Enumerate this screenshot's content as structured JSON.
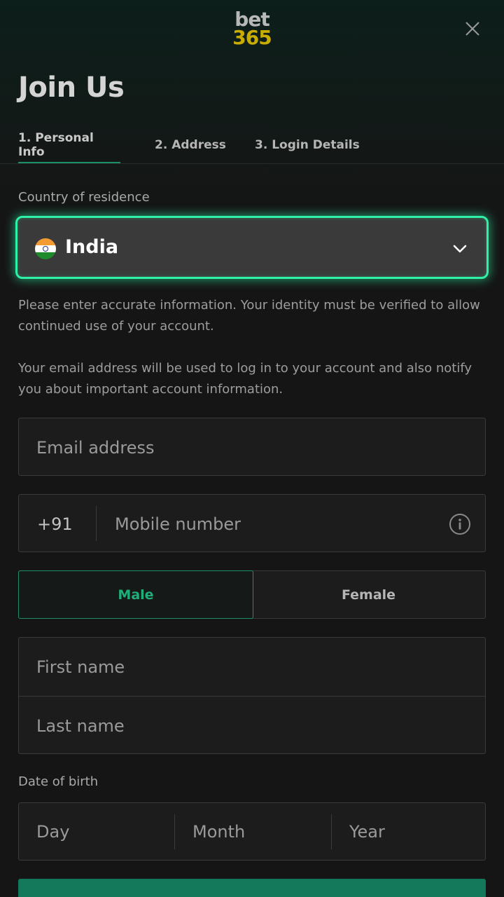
{
  "header": {
    "logo_line1": "bet",
    "logo_line2": "365",
    "title": "Join Us"
  },
  "tabs": [
    {
      "label": "1. Personal Info",
      "active": true
    },
    {
      "label": "2. Address",
      "active": false
    },
    {
      "label": "3. Login Details",
      "active": false
    }
  ],
  "country": {
    "label": "Country of residence",
    "value": "India",
    "flag_icon": "india-flag-icon"
  },
  "info": {
    "identity_text": "Please enter accurate information. Your identity must be verified to allow continued use of your account.",
    "email_text": "Your email address will be used to log in to your account and also notify you about important account information."
  },
  "form": {
    "email_placeholder": "Email address",
    "phone_code": "+91",
    "mobile_placeholder": "Mobile number",
    "gender_male": "Male",
    "gender_female": "Female",
    "gender_selected": "Male",
    "first_name_placeholder": "First name",
    "last_name_placeholder": "Last name",
    "dob_label": "Date of birth",
    "dob_day": "Day",
    "dob_month": "Month",
    "dob_year": "Year"
  },
  "colors": {
    "accent": "#2ef0a6",
    "brand_green": "#14795a",
    "logo_yellow": "#c8ad00"
  }
}
